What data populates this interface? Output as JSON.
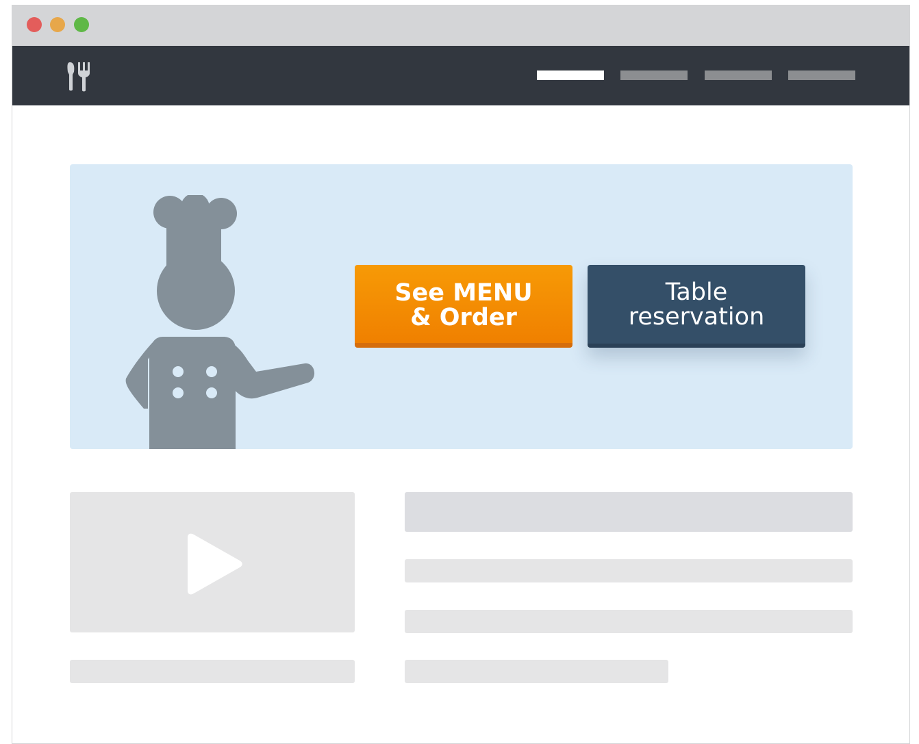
{
  "window": {
    "controls": [
      {
        "name": "close",
        "color": "#e35d5b"
      },
      {
        "name": "minimize",
        "color": "#e7a74a"
      },
      {
        "name": "maximize",
        "color": "#5fb847"
      }
    ]
  },
  "navbar": {
    "logo_icon": "fork-knife-icon",
    "active_index": 0,
    "link_count": 4
  },
  "hero": {
    "illustration_icon": "chef-icon",
    "menu_button": {
      "line1": "See MENU",
      "line2": "& Order",
      "color": "#f28c00"
    },
    "reservation_button": {
      "line1": "Table",
      "line2": "reservation",
      "color": "#344f68"
    }
  },
  "content": {
    "video_icon": "play-icon"
  },
  "colors": {
    "navbar": "#32373f",
    "hero_background": "#d9eaf7",
    "placeholder": "#e5e5e6",
    "placeholder_dark": "#dcdde1"
  }
}
